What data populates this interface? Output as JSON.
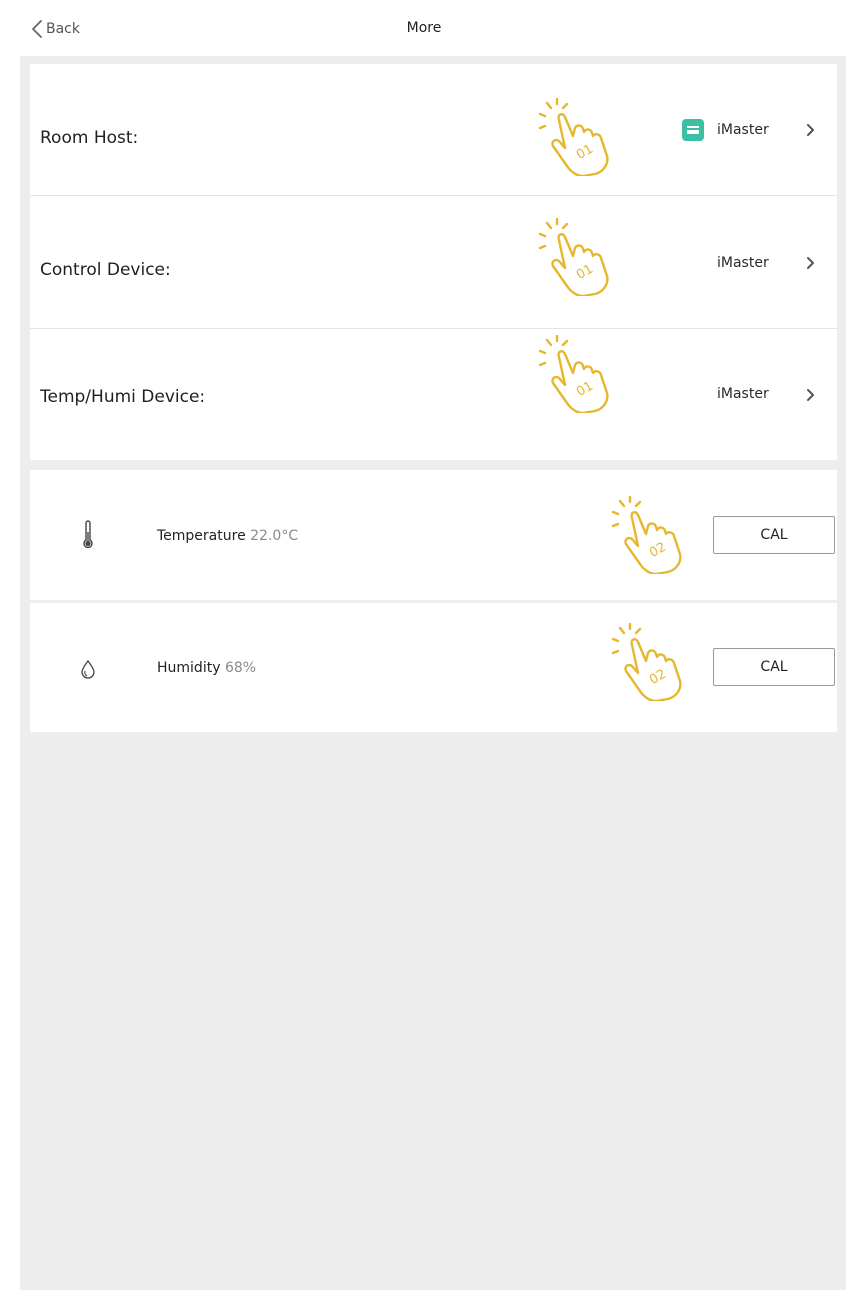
{
  "header": {
    "back_label": "Back",
    "title": "More"
  },
  "devices": [
    {
      "label": "Room Host:",
      "value": "iMaster",
      "icon": "router-icon",
      "hint": "01"
    },
    {
      "label": "Control Device:",
      "value": "iMaster",
      "hint": "01"
    },
    {
      "label": "Temp/Humi Device:",
      "value": "iMaster",
      "hint": "01"
    }
  ],
  "sensors": [
    {
      "name": "Temperature",
      "value": "22.0°C",
      "icon": "thermometer-icon",
      "button": "CAL",
      "hint": "02"
    },
    {
      "name": "Humidity",
      "value": "68%",
      "icon": "droplet-icon",
      "button": "CAL",
      "hint": "02"
    }
  ],
  "colors": {
    "accent_hand": "#e6b72c",
    "host_icon": "#3bbfa5",
    "background": "#ededed"
  }
}
